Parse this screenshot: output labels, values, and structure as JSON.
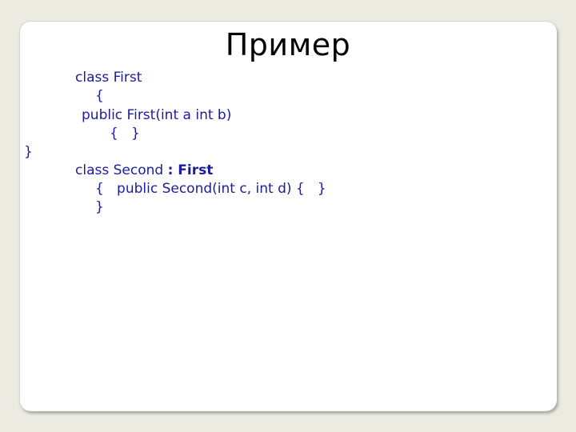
{
  "slide": {
    "title": "Пример",
    "code_lines": [
      "class First",
      "{",
      "public First(int a int b)",
      "{   }",
      "}",
      "class Second ",
      ": First",
      "{   public Second(int c, int d) {   }",
      "}"
    ]
  },
  "colors": {
    "background": "#ecebe1",
    "slide": "#ffffff",
    "title": "#000000",
    "code": "#1c1ca0"
  }
}
